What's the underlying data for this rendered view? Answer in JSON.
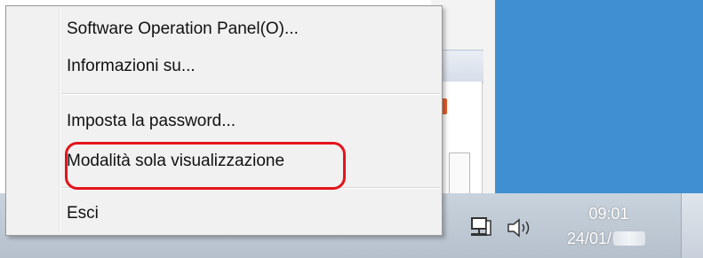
{
  "menu": {
    "items": [
      {
        "label": "Software Operation Panel(O)..."
      },
      {
        "label": "Informazioni su..."
      },
      {
        "label": "Imposta la password..."
      },
      {
        "label": "Modalità sola visualizzazione",
        "highlighted": true
      },
      {
        "label": "Esci"
      }
    ]
  },
  "taskbar": {
    "clock": {
      "time": "09:01",
      "date_visible": "24/01/"
    },
    "tray_icons": [
      "flag-icon",
      "network-icon",
      "volume-icon"
    ]
  },
  "colors": {
    "highlight": "#e3141c",
    "desktop": "#3f8fd2",
    "menu_bg": "#f1f1f1"
  }
}
